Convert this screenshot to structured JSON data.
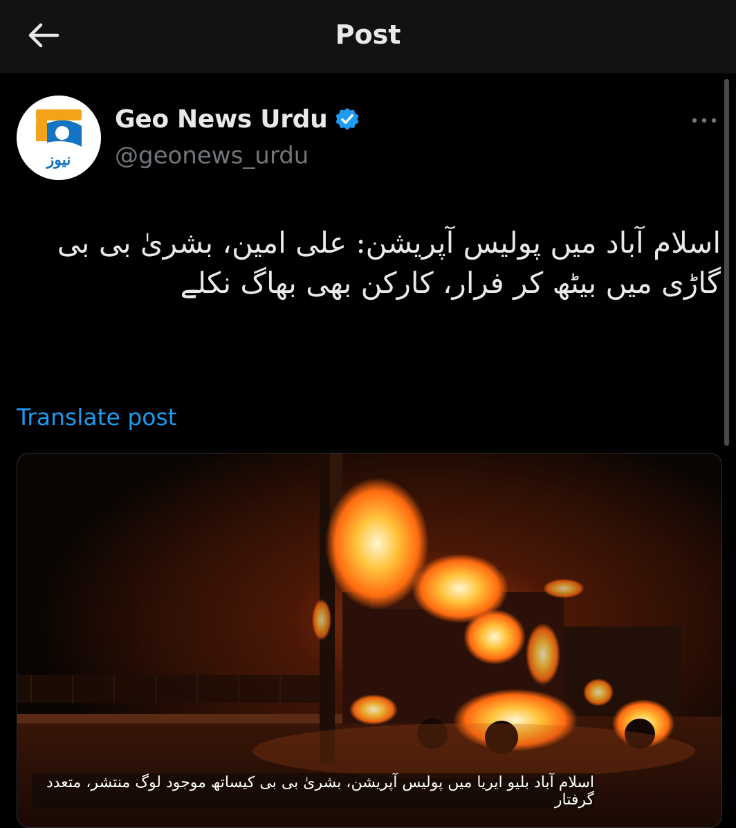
{
  "header": {
    "title": "Post",
    "back_icon": "arrow-left-icon"
  },
  "author": {
    "name": "Geo News Urdu",
    "handle": "@geonews_urdu",
    "verified": true,
    "avatar_icon": "geo-news-logo",
    "avatar_text": "نیوز"
  },
  "post": {
    "text": "اسلام آباد میں پولیس آپریشن: علی امین، بشریٰ بی بی گاڑی میں بیٹھ کر فرار، کارکن بھی بھاگ نکلے",
    "translate_label": "Translate post"
  },
  "media": {
    "caption": "اسلام آباد بلیو ایریا میں پولیس آپریشن، بشریٰ بی بی کیساتھ موجود لوگ منتشر، متعدد گرفتار"
  },
  "colors": {
    "background": "#000000",
    "header_bg": "#121212",
    "link": "#1d9bf0",
    "secondary_text": "#71767b",
    "verified": "#1d9bf0"
  }
}
